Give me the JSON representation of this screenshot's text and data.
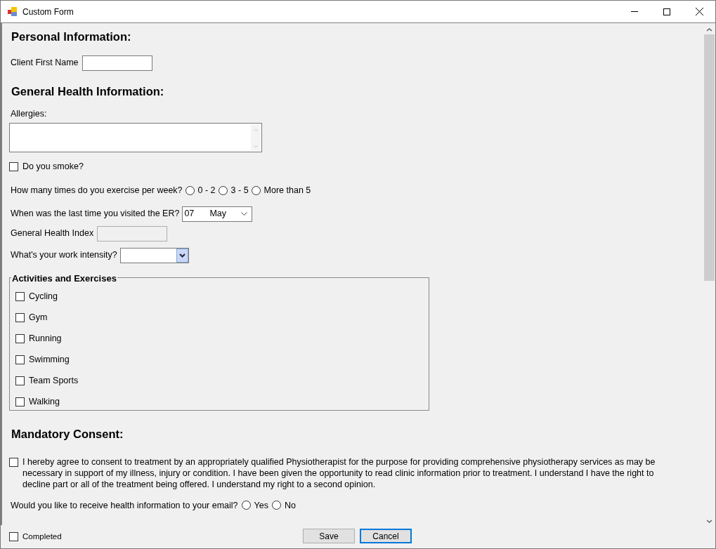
{
  "window": {
    "title": "Custom Form"
  },
  "personal": {
    "heading": "Personal Information:",
    "first_name": {
      "label": "Client First Name"
    }
  },
  "health": {
    "heading": "General Health Information:",
    "allergies": {
      "label": "Allergies:"
    },
    "smoke": {
      "label": "Do you smoke?",
      "checked": false
    },
    "exercise": {
      "question": "How many times do you exercise per week?",
      "options": [
        {
          "label": "0 - 2",
          "selected": false
        },
        {
          "label": "3 - 5",
          "selected": false
        },
        {
          "label": "More than 5",
          "selected": false
        }
      ]
    },
    "er_visit": {
      "question": "When was the last time you visited the ER?",
      "day": "07",
      "month": "May"
    },
    "health_index": {
      "label": "General Health Index",
      "disabled": true
    },
    "work_intensity": {
      "label": "What's your work intensity?"
    }
  },
  "activities": {
    "title": "Activities and Exercises",
    "items": [
      {
        "label": "Cycling",
        "checked": false
      },
      {
        "label": "Gym",
        "checked": false
      },
      {
        "label": "Running",
        "checked": false
      },
      {
        "label": "Swimming",
        "checked": false
      },
      {
        "label": "Team Sports",
        "checked": false
      },
      {
        "label": "Walking",
        "checked": false
      }
    ]
  },
  "consent": {
    "heading": "Mandatory Consent:",
    "text": "I hereby agree to consent to treatment by an appropriately qualified Physiotherapist for the purpose for providing comprehensive physiotherapy services as may be necessary in support of my illness, injury or condition.  I have been given the opportunity to read clinic information prior to treatment.  I understand I have the right to decline part or all of the treatment being offered.  I understand my right to a second opinion.",
    "checked": false,
    "email": {
      "question": "Would you like to receive health information to your email?",
      "options": [
        {
          "label": "Yes",
          "selected": false
        },
        {
          "label": "No",
          "selected": false
        }
      ]
    }
  },
  "footer": {
    "completed": {
      "label": "Completed",
      "checked": false
    },
    "buttons": [
      {
        "label": "Save",
        "kind": "normal"
      },
      {
        "label": "Cancel",
        "kind": "default"
      }
    ]
  }
}
